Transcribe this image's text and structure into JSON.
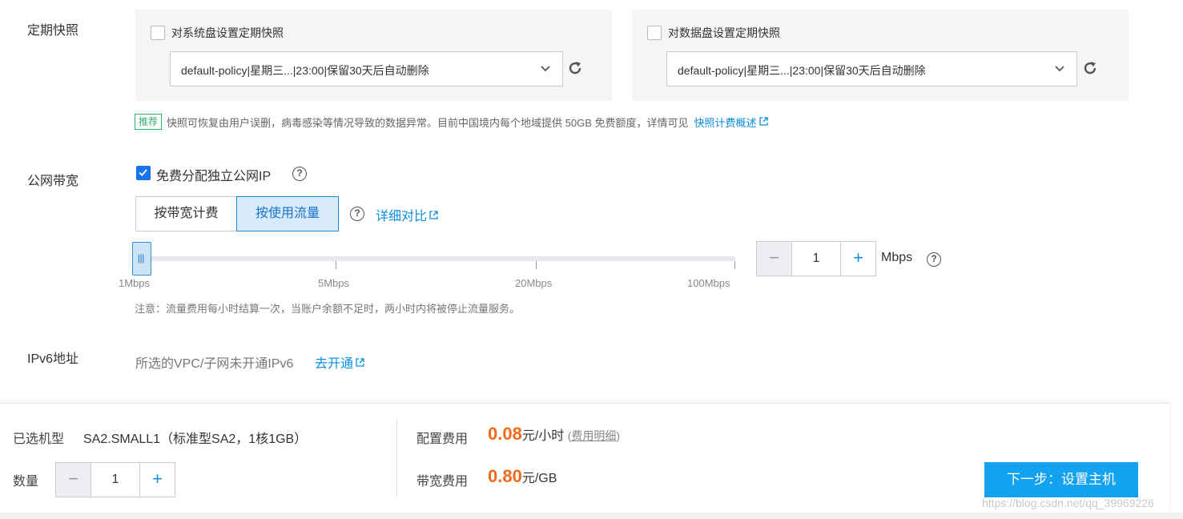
{
  "snapshot": {
    "label": "定期快照",
    "system_disk": {
      "checkbox_label": "对系统盘设置定期快照",
      "policy_value": "default-policy|星期三...|23:00|保留30天后自动删除"
    },
    "data_disk": {
      "checkbox_label": "对数据盘设置定期快照",
      "policy_value": "default-policy|星期三...|23:00|保留30天后自动删除"
    },
    "tip_badge": "推荐",
    "tip_text": "快照可恢复由用户误删，病毒感染等情况导致的数据异常。目前中国境内每个地域提供 50GB 免费额度，详情可见",
    "tip_link": "快照计费概述"
  },
  "bandwidth": {
    "label": "公网带宽",
    "free_ip_label": "免费分配独立公网IP",
    "billing_options": [
      "按带宽计费",
      "按使用流量"
    ],
    "selected_billing": "按使用流量",
    "compare_link": "详细对比",
    "slider_ticks": [
      "1Mbps",
      "5Mbps",
      "20Mbps",
      "100Mbps"
    ],
    "slider_value_fraction": 0,
    "value": "1",
    "unit": "Mbps",
    "note": "注意：流量费用每小时结算一次，当账户余额不足时，两小时内将被停止流量服务。"
  },
  "ipv6": {
    "label": "IPv6地址",
    "text": "所选的VPC/子网未开通IPv6",
    "link": "去开通"
  },
  "footer": {
    "model_label": "已选机型",
    "model_value": "SA2.SMALL1（标准型SA2，1核1GB）",
    "quantity_label": "数量",
    "quantity_value": "1",
    "config_fee_label": "配置费用",
    "config_fee_value": "0.08",
    "config_fee_unit": "元/小时",
    "fee_detail_open": "(",
    "fee_detail_link": "费用明细",
    "fee_detail_close": ")",
    "bandwidth_fee_label": "带宽费用",
    "bandwidth_fee_value": "0.80",
    "bandwidth_fee_unit": "元/GB",
    "next_button": "下一步：设置主机"
  },
  "watermark": "https://blog.csdn.net/qq_39969226",
  "colors": {
    "accent": "#12a2f0",
    "price": "#f06a1a",
    "link": "#0a8de0",
    "badge": "#32b16c"
  }
}
